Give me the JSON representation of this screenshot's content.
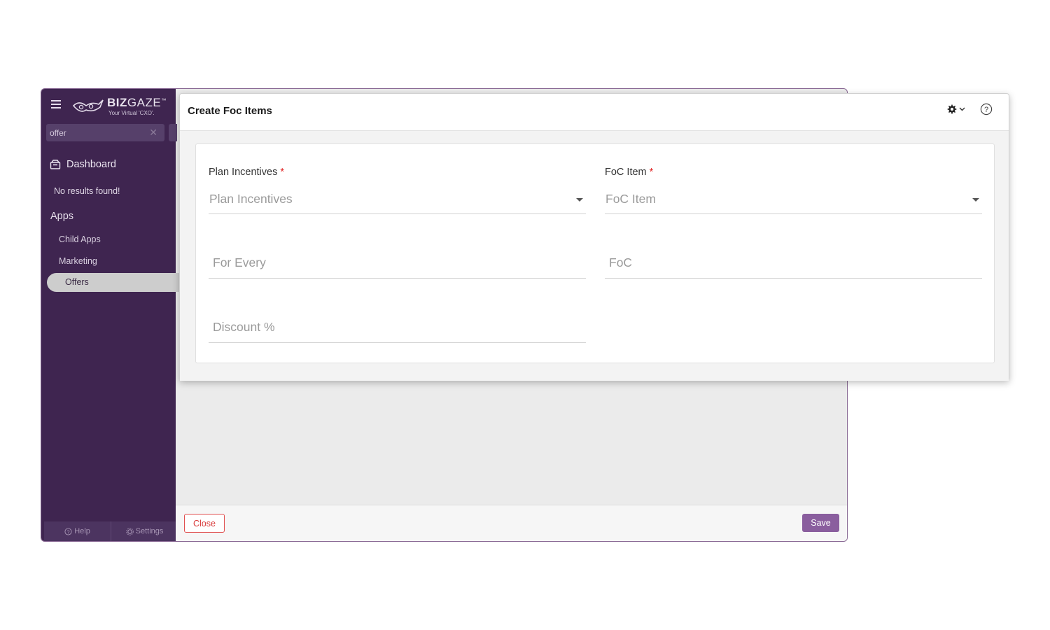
{
  "app": {
    "logo": {
      "brand_bold": "BIZ",
      "brand_thin": "GAZE",
      "tm": "™",
      "tagline": "Your Virtual 'CXO'."
    },
    "search": {
      "value": "offer",
      "clear_icon": "close-icon"
    },
    "nav": {
      "dashboard": "Dashboard",
      "no_results": "No results found!",
      "apps_heading": "Apps",
      "child_apps": "Child Apps",
      "marketing": "Marketing",
      "offers": "Offers"
    },
    "footer": {
      "help": "Help",
      "settings": "Settings"
    }
  },
  "actions": {
    "close": "Close",
    "save": "Save"
  },
  "modal": {
    "title": "Create Foc Items",
    "fields": {
      "plan_incentives": {
        "label": "Plan Incentives",
        "required": "*",
        "placeholder": "Plan Incentives"
      },
      "foc_item": {
        "label": "FoC Item",
        "required": "*",
        "placeholder": "FoC Item"
      },
      "for_every": {
        "placeholder": "For Every"
      },
      "foc": {
        "placeholder": "FoC"
      },
      "discount": {
        "placeholder": "Discount %"
      }
    }
  },
  "colors": {
    "sidebar": "#3f2550",
    "accent": "#8a5e9e",
    "danger": "#e05050"
  }
}
